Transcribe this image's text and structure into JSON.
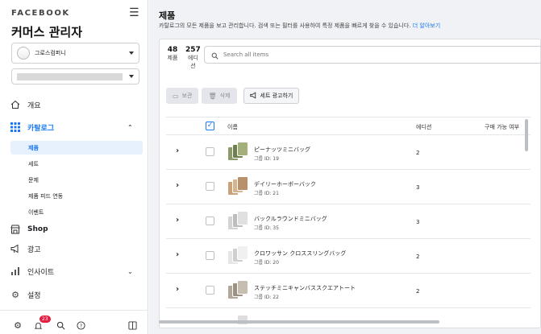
{
  "sidebar": {
    "brand": "FACEBOOK",
    "title": "커머스 관리자",
    "account": {
      "name": "그로스컴퍼니"
    },
    "nav": [
      {
        "label": "개요",
        "icon": "home-icon"
      },
      {
        "label": "카탈로그",
        "icon": "grid-icon"
      },
      {
        "label": "Shop",
        "icon": "shop-icon"
      },
      {
        "label": "광고",
        "icon": "megaphone-icon"
      },
      {
        "label": "인사이트",
        "icon": "chart-icon"
      },
      {
        "label": "설정",
        "icon": "gear-icon"
      }
    ],
    "catalog_sub": [
      "제품",
      "세트",
      "문제",
      "제품 피드 연동",
      "이벤트"
    ],
    "notification_count": "23"
  },
  "main": {
    "title": "제품",
    "description": "카탈로그의 모든 제품을 보고 관리합니다. 검색 또는 필터를 사용하여 특정 제품을 빠르게 찾을 수 있습니다.",
    "learn_more": "더 알아보기",
    "counts": [
      {
        "num": "48",
        "label": "제품"
      },
      {
        "num": "257",
        "label": "에디션"
      }
    ],
    "search_placeholder": "Search all items",
    "toolbar": {
      "save": "보관",
      "delete": "삭제",
      "set_ad": "세트 광고하기"
    },
    "table": {
      "col_name": "이름",
      "col_variants": "에디션",
      "col_availability": "구매 가능 여부",
      "rows": [
        {
          "name": "ピーナッツミニバッグ",
          "group_id": "그룹 ID: 19",
          "variants": "2"
        },
        {
          "name": "デイリーホーボーバック",
          "group_id": "그룹 ID: 21",
          "variants": "3"
        },
        {
          "name": "バックルラウンドミニバッグ",
          "group_id": "그룹 ID: 35",
          "variants": "3"
        },
        {
          "name": "クロワッサン クロススリングバッグ",
          "group_id": "그룹 ID: 20",
          "variants": "2"
        },
        {
          "name": "ステッチミニキャンバススクエアトート",
          "group_id": "그룹 ID: 22",
          "variants": "2"
        }
      ]
    }
  }
}
